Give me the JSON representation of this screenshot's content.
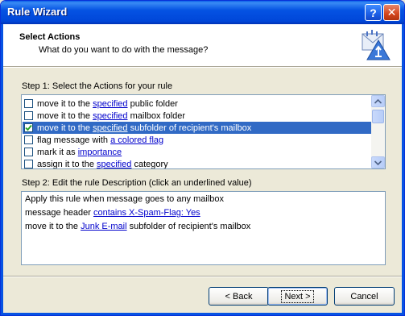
{
  "window": {
    "title": "Rule Wizard"
  },
  "header": {
    "title": "Select Actions",
    "subtitle": "What do you want to do with the message?"
  },
  "step1": {
    "label": "Step 1: Select the Actions for your rule",
    "actions": [
      {
        "checked": false,
        "selected": false,
        "prefix": "move it to the ",
        "link": "specified",
        "suffix": " public folder"
      },
      {
        "checked": false,
        "selected": false,
        "prefix": "move it to the ",
        "link": "specified",
        "suffix": " mailbox folder"
      },
      {
        "checked": true,
        "selected": true,
        "prefix": "move it to the ",
        "link": "specified",
        "suffix": " subfolder of recipient's mailbox"
      },
      {
        "checked": false,
        "selected": false,
        "prefix": "flag message with ",
        "link": "a colored flag",
        "suffix": ""
      },
      {
        "checked": false,
        "selected": false,
        "prefix": "mark it as ",
        "link": "importance",
        "suffix": ""
      },
      {
        "checked": false,
        "selected": false,
        "prefix": "assign it to the ",
        "link": "specified",
        "suffix": " category"
      }
    ]
  },
  "step2": {
    "label": "Step 2: Edit the rule Description (click an underlined value)",
    "line1": "Apply this rule when message goes to any mailbox",
    "line2_prefix": "message header ",
    "line2_link": "contains X-Spam-Flag: Yes",
    "line3_prefix": "move it to the ",
    "line3_link": "Junk E-mail",
    "line3_suffix": " subfolder of recipient's mailbox"
  },
  "buttons": {
    "back_label": "< Back",
    "next_label": "Next >",
    "cancel_label": "Cancel"
  },
  "icons": {
    "help": "question-mark-icon",
    "close": "close-icon",
    "header": "rule-wizard-icon"
  },
  "colors": {
    "selection": "#316ac5",
    "link": "#0000cc",
    "titlebar": "#0553e3"
  }
}
